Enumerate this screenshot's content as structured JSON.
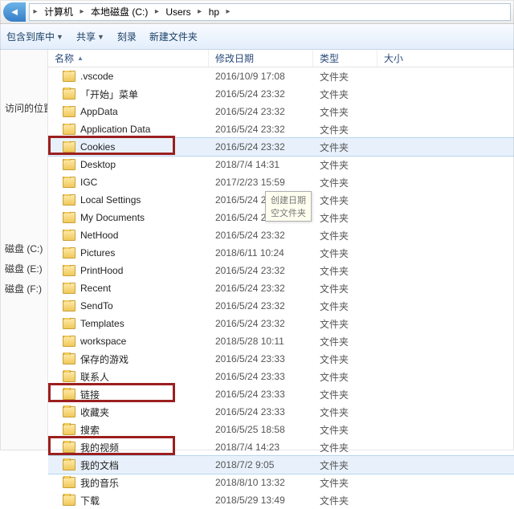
{
  "breadcrumb": {
    "parts": [
      "计算机",
      "本地磁盘 (C:)",
      "Users",
      "hp"
    ]
  },
  "toolbar": {
    "organize": "包含到库中",
    "share": "共享",
    "burn": "刻录",
    "newfolder": "新建文件夹"
  },
  "nav": {
    "recent": "访问的位置",
    "c": "磁盘 (C:)",
    "e": "磁盘 (E:)",
    "f": "磁盘 (F:)"
  },
  "columns": {
    "name": "名称",
    "date": "修改日期",
    "type": "类型",
    "size": "大小"
  },
  "type_folder": "文件夹",
  "tooltip": {
    "l1": "创建日期",
    "l2": "空文件夹"
  },
  "items": [
    {
      "name": ".vscode",
      "date": "2016/10/9 17:08"
    },
    {
      "name": "「开始」菜单",
      "date": "2016/5/24 23:32"
    },
    {
      "name": "AppData",
      "date": "2016/5/24 23:32"
    },
    {
      "name": "Application Data",
      "date": "2016/5/24 23:32"
    },
    {
      "name": "Cookies",
      "date": "2016/5/24 23:32",
      "sel": true
    },
    {
      "name": "Desktop",
      "date": "2018/7/4 14:31",
      "hl": true
    },
    {
      "name": "IGC",
      "date": "2017/2/23 15:59"
    },
    {
      "name": "Local Settings",
      "date": "2016/5/24 23:32"
    },
    {
      "name": "My Documents",
      "date": "2016/5/24 23:32"
    },
    {
      "name": "NetHood",
      "date": "2016/5/24 23:32"
    },
    {
      "name": "Pictures",
      "date": "2018/6/11 10:24"
    },
    {
      "name": "PrintHood",
      "date": "2016/5/24 23:32"
    },
    {
      "name": "Recent",
      "date": "2016/5/24 23:32"
    },
    {
      "name": "SendTo",
      "date": "2016/5/24 23:32"
    },
    {
      "name": "Templates",
      "date": "2016/5/24 23:32"
    },
    {
      "name": "workspace",
      "date": "2018/5/28 10:11"
    },
    {
      "name": "保存的游戏",
      "date": "2016/5/24 23:33"
    },
    {
      "name": "联系人",
      "date": "2016/5/24 23:33"
    },
    {
      "name": "链接",
      "date": "2016/5/24 23:33"
    },
    {
      "name": "收藏夹",
      "date": "2016/5/24 23:33",
      "hl": true
    },
    {
      "name": "搜索",
      "date": "2016/5/25 18:58"
    },
    {
      "name": "我的视频",
      "date": "2018/7/4 14:23"
    },
    {
      "name": "我的文档",
      "date": "2018/7/2 9:05",
      "hl": true,
      "sel": true
    },
    {
      "name": "我的音乐",
      "date": "2018/8/10 13:32"
    },
    {
      "name": "下载",
      "date": "2018/5/29 13:49"
    }
  ]
}
